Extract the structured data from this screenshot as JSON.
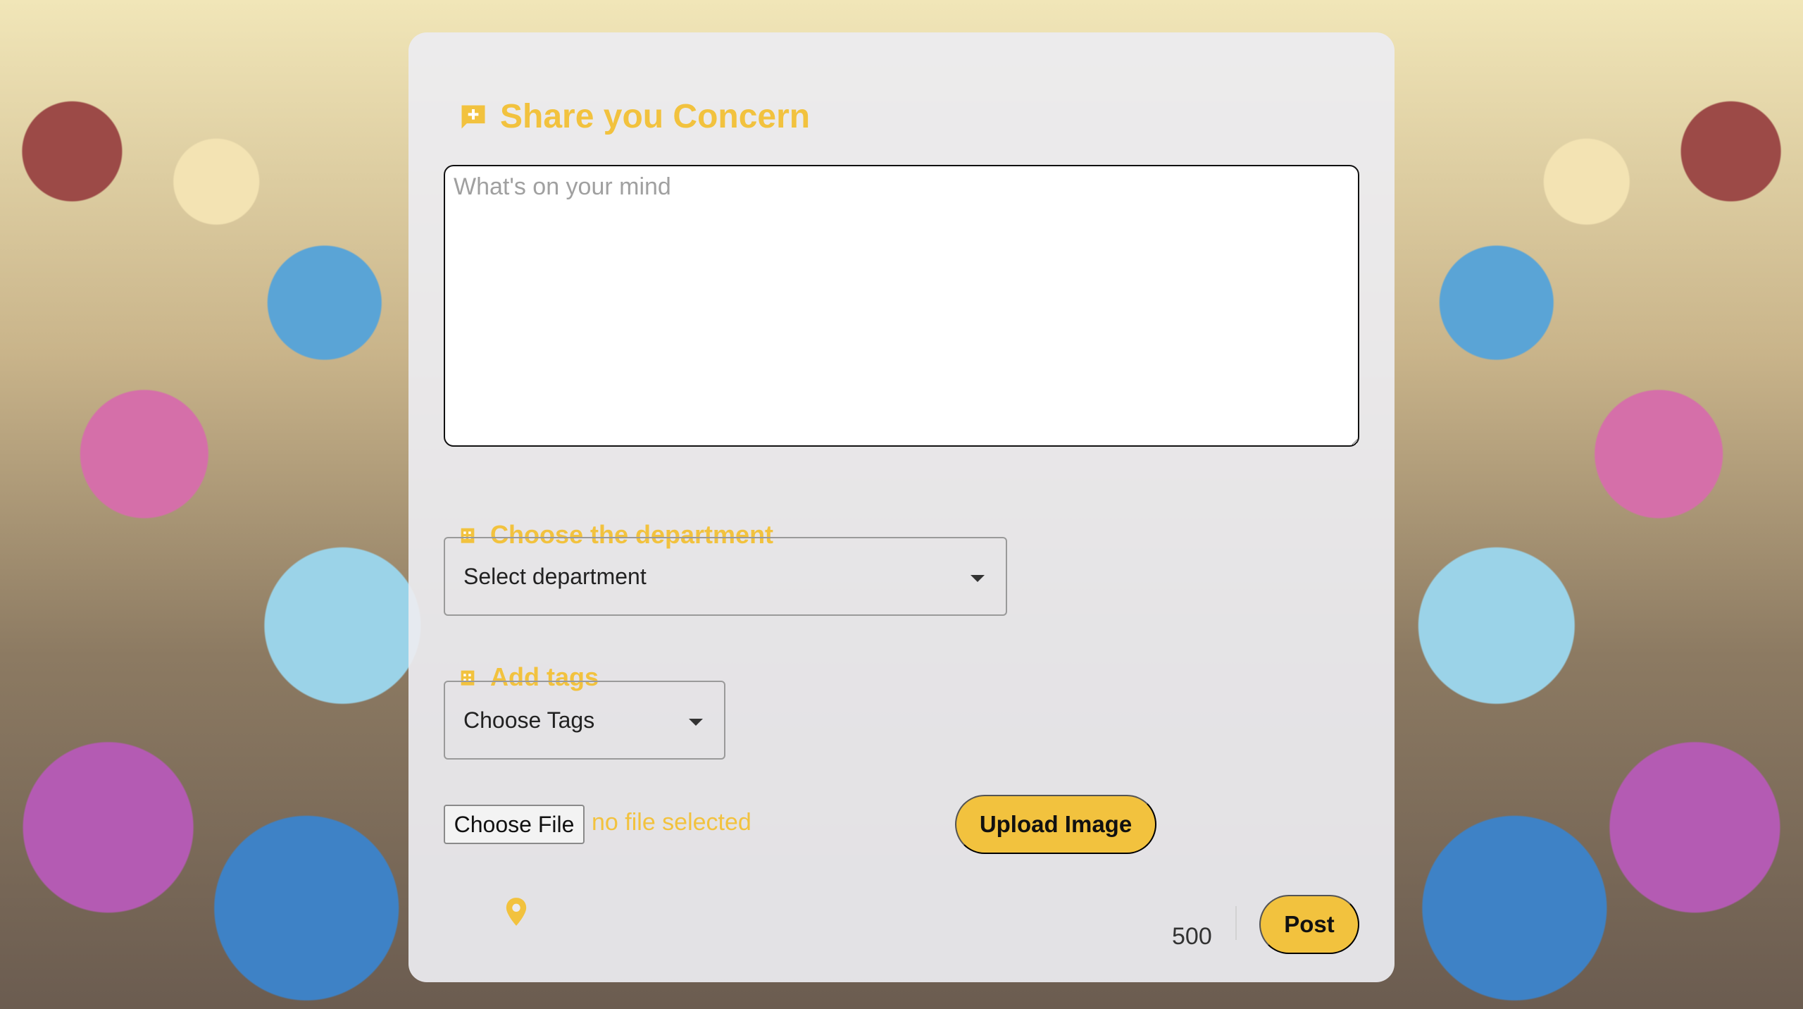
{
  "form": {
    "title": "Share you Concern",
    "textarea_placeholder": "What's on your mind",
    "department_label": "Choose the department",
    "department_select": "Select department",
    "tags_label": "Add tags",
    "tags_select": "Choose Tags",
    "file_button": "Choose File",
    "file_status": "no file selected",
    "upload_button": "Upload Image",
    "char_count": "500",
    "post_button": "Post"
  },
  "icons": {
    "title": "chat-add-icon",
    "department": "building-icon",
    "tags": "building-icon",
    "location": "location-pin-icon"
  },
  "colors": {
    "accent": "#f2c23e",
    "card": "#ececf0"
  }
}
